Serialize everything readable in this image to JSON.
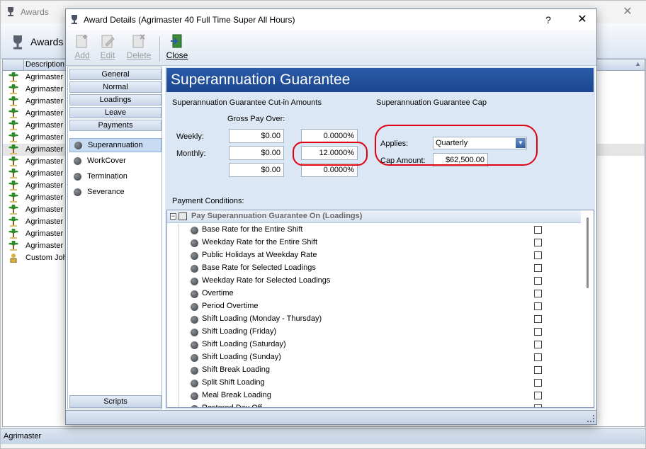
{
  "background_window": {
    "title": "Awards",
    "ribbon_button": "Awards",
    "grid_header": "Description",
    "rows": [
      "Agrimaster",
      "Agrimaster",
      "Agrimaster",
      "Agrimaster",
      "Agrimaster",
      "Agrimaster",
      "Agrimaster",
      "Agrimaster",
      "Agrimaster",
      "Agrimaster",
      "Agrimaster",
      "Agrimaster",
      "Agrimaster",
      "Agrimaster",
      "Agrimaster",
      "Custom Joh"
    ],
    "status": "Agrimaster"
  },
  "dialog": {
    "title": "Award Details (Agrimaster 40 Full Time Super All Hours)",
    "help_glyph": "?",
    "close_glyph": "✕",
    "toolbar": {
      "add": "Add",
      "edit": "Edit",
      "delete": "Delete",
      "close": "Close"
    }
  },
  "nav": {
    "tabs": [
      "General",
      "Normal",
      "Loadings",
      "Leave",
      "Payments"
    ],
    "items": [
      "Superannuation",
      "WorkCover",
      "Termination",
      "Severance"
    ],
    "selected": "Superannuation",
    "bottom_tab": "Scripts"
  },
  "content": {
    "header": "Superannuation Guarantee",
    "cutin": {
      "title": "Superannuation Guarantee Cut-in Amounts",
      "gross_pay_label": "Gross Pay Over:",
      "rows": [
        {
          "label": "Weekly:",
          "amount": "$0.00",
          "percent": "0.0000%"
        },
        {
          "label": "Monthly:",
          "amount": "$0.00",
          "percent": "12.0000%"
        },
        {
          "label": "",
          "amount": "$0.00",
          "percent": "0.0000%"
        }
      ]
    },
    "cap": {
      "title": "Superannuation Guarantee Cap",
      "applies_label": "Applies:",
      "applies_value": "Quarterly",
      "cap_amount_label": "Cap Amount:",
      "cap_amount_value": "$62,500.00"
    },
    "payment_conditions_label": "Payment Conditions:",
    "conditions_group": "Pay Superannuation Guarantee On (Loadings)",
    "conditions": [
      "Base Rate for the Entire Shift",
      "Weekday Rate for the Entire Shift",
      "Public Holidays at Weekday Rate",
      "Base Rate for Selected Loadings",
      "Weekday Rate for Selected Loadings",
      "Overtime",
      "Period Overtime",
      "Shift Loading (Monday - Thursday)",
      "Shift Loading (Friday)",
      "Shift Loading (Saturday)",
      "Shift Loading (Sunday)",
      "Shift Break Loading",
      "Split Shift Loading",
      "Meal Break Loading",
      "Rostered Day Off"
    ]
  },
  "colors": {
    "header_blue": "#1c4690",
    "highlight_red": "#e00010",
    "panel_bg": "#dce7f5"
  }
}
